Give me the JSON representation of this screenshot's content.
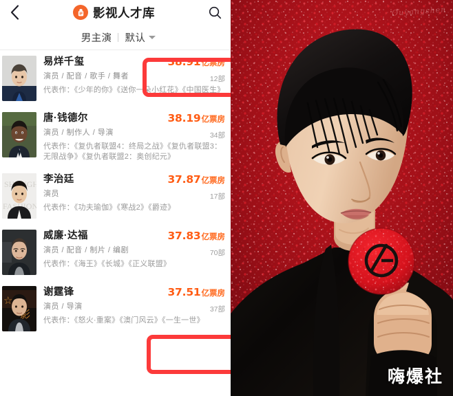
{
  "app": {
    "title": "影视人才库",
    "back_icon": "chevron-left-icon",
    "search_icon": "search-icon",
    "logo_icon": "app-logo-icon",
    "logo_color": "#f4652a"
  },
  "filters": {
    "category_label": "男主演",
    "sort_label": "默认",
    "sort_caret_icon": "chevron-down-icon"
  },
  "list": [
    {
      "name": "易烊千玺",
      "roles": "演员 / 配音 / 歌手 / 舞者",
      "works": "代表作：《少年的你》《送你一朵小红花》《中国医生》",
      "boxoffice_value": "38.91",
      "boxoffice_unit": "亿票房",
      "film_count": "12部",
      "highlighted": true
    },
    {
      "name": "唐·钱德尔",
      "roles": "演员 / 制作人 / 导演",
      "works": "代表作：《复仇者联盟4：终局之战》《复仇者联盟3：无限战争》《复仇者联盟2：奥创纪元》",
      "boxoffice_value": "38.19",
      "boxoffice_unit": "亿票房",
      "film_count": "34部",
      "highlighted": false
    },
    {
      "name": "李治廷",
      "roles": "演员",
      "works": "代表作：《功夫瑜伽》《寒战2》《爵迹》",
      "boxoffice_value": "37.87",
      "boxoffice_unit": "亿票房",
      "film_count": "17部",
      "highlighted": false
    },
    {
      "name": "威廉·达福",
      "roles": "演员 / 配音 / 制片 / 编剧",
      "works": "代表作：《海王》《长城》《正义联盟》",
      "boxoffice_value": "37.83",
      "boxoffice_unit": "亿票房",
      "film_count": "70部",
      "highlighted": false
    },
    {
      "name": "谢霆锋",
      "roles": "演员 / 导演",
      "works": "代表作：《怒火·重案》《澳门风云》《一生一世》",
      "boxoffice_value": "37.51",
      "boxoffice_unit": "亿票房",
      "film_count": "37部",
      "highlighted": true
    }
  ],
  "annotation": {
    "color": "#fc3a3a",
    "box_count": 2
  },
  "poster": {
    "watermark_script": "Ouyangshen",
    "brandmark": "嗨爆社",
    "background_color": "#9e1018",
    "compact_logo": "giorgio-armani-logo"
  }
}
